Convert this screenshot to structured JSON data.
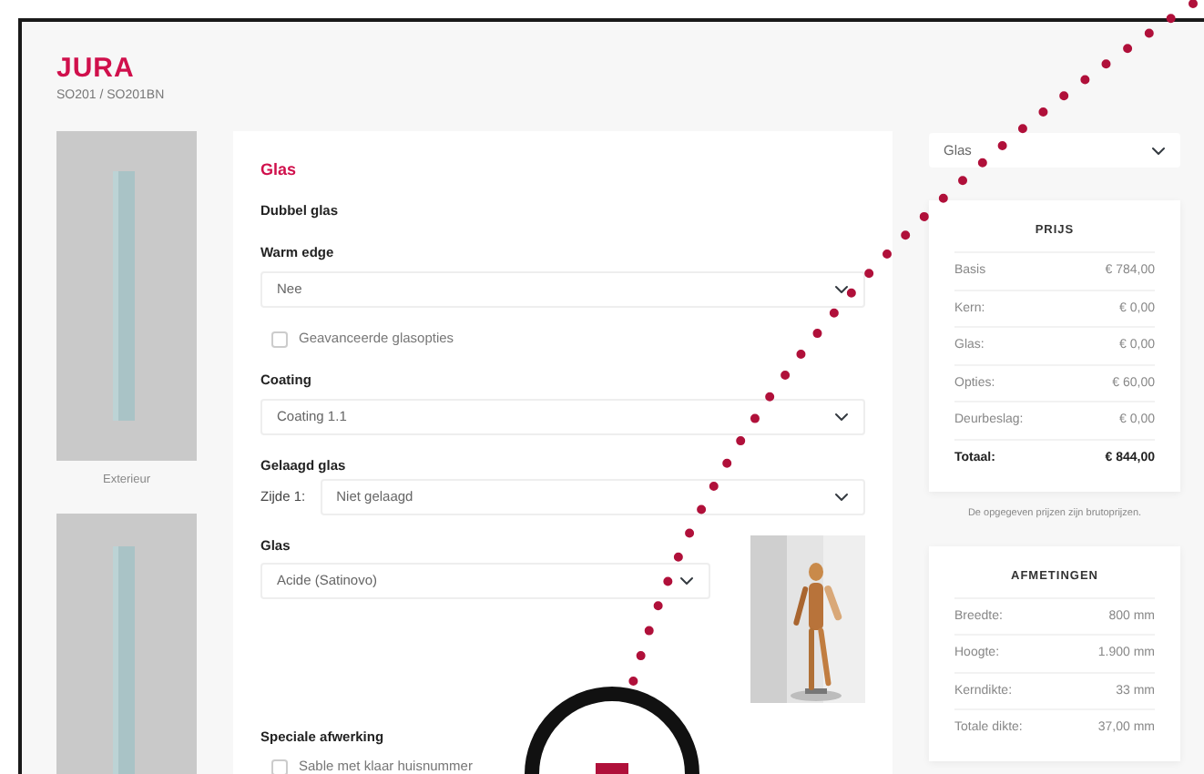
{
  "header": {
    "title": "JURA",
    "subtitle": "SO201 / SO201BN"
  },
  "door_caption": "Exterieur",
  "glass_section": {
    "heading": "Glas",
    "subheading": "Dubbel glas",
    "fields": [
      {
        "kind": "select",
        "label": "Warm edge",
        "value": "Nee"
      },
      {
        "kind": "checkbox",
        "label": "Geavanceerde glasopties",
        "checked": false
      },
      {
        "kind": "select",
        "label": "Coating",
        "value": "Coating 1.1"
      },
      {
        "kind": "prefixed-select",
        "label": "Gelaagd glas",
        "prefix": "Zijde 1:",
        "value": "Niet gelaagd"
      },
      {
        "kind": "photo-select",
        "label": "Glas",
        "value": "Acide (Satinovo)"
      },
      {
        "kind": "checkbox-group",
        "label": "Speciale afwerking",
        "options": [
          {
            "label": "Sable met klaar huisnummer",
            "checked": false
          }
        ]
      }
    ]
  },
  "section_select": {
    "value": "Glas"
  },
  "price": {
    "title": "PRIJS",
    "rows": [
      {
        "label": "Basis",
        "value": "€ 784,00",
        "total": false
      },
      {
        "label": "Kern:",
        "value": "€ 0,00",
        "total": false
      },
      {
        "label": "Glas:",
        "value": "€ 0,00",
        "total": false
      },
      {
        "label": "Opties:",
        "value": "€ 60,00",
        "total": false
      },
      {
        "label": "Deurbeslag:",
        "value": "€ 0,00",
        "total": false
      },
      {
        "label": "Totaal:",
        "value": "€ 844,00",
        "total": true
      }
    ]
  },
  "price_note": "De opgegeven prijzen zijn brutoprijzen.",
  "dimensions": {
    "title": "AFMETINGEN",
    "rows": [
      {
        "label": "Breedte:",
        "value": "800 mm"
      },
      {
        "label": "Hoogte:",
        "value": "1.900 mm"
      },
      {
        "label": "Kerndikte:",
        "value": "33 mm"
      },
      {
        "label": "Totale dikte:",
        "value": "37,00 mm"
      }
    ]
  }
}
